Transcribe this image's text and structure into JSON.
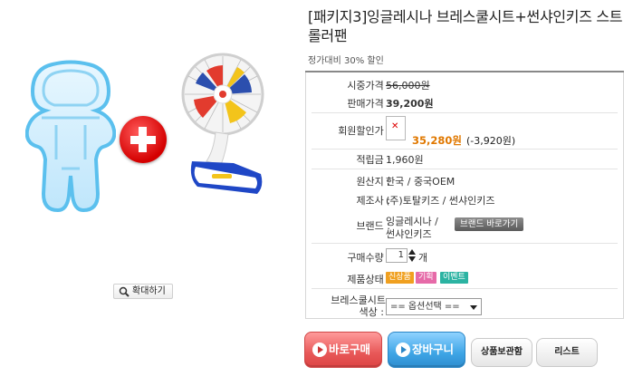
{
  "product": {
    "title": "[패키지3]잉글레시나 브레스쿨시트+썬샤인키즈 스트롤러팬",
    "discount_note": "정가대비 30% 할인",
    "zoom_label": "확대하기"
  },
  "info": {
    "list_price_label": "시중가격 :",
    "list_price": "56,000원",
    "sale_price_label": "판매가격 :",
    "sale_price": "39,200원",
    "member_price_label": "회원할인가 :",
    "member_price": "35,280원",
    "member_diff": "(-3,920원)",
    "points_label": "적립금 :",
    "points": "1,960원",
    "origin_label": "원산지 :",
    "origin": "한국 / 중국OEM",
    "maker_label": "제조사 :",
    "maker": "(주)토탈키즈 / 썬샤인키즈",
    "brand_label": "브랜드 :",
    "brand_line1": "잉글레시나 /",
    "brand_line2": "썬샤인키즈",
    "brand_button": "브랜드 바로가기",
    "qty_label": "구매수량 :",
    "qty_value": "1",
    "qty_unit": "개",
    "status_label": "제품상태 :",
    "status_badges": [
      {
        "label": "신상품",
        "color": "#f0a020"
      },
      {
        "label": "기획",
        "color": "#e66aa8"
      },
      {
        "label": "이벤트",
        "color": "#2bb3a2"
      }
    ],
    "option_label_line1": "브레스쿨시트",
    "option_label_line2": "색상 :",
    "option_value": "== 옵션선택 =="
  },
  "actions": {
    "buy_now": "바로구매",
    "cart": "장바구니",
    "wishlist": "상품보관함",
    "list": "리스트"
  }
}
